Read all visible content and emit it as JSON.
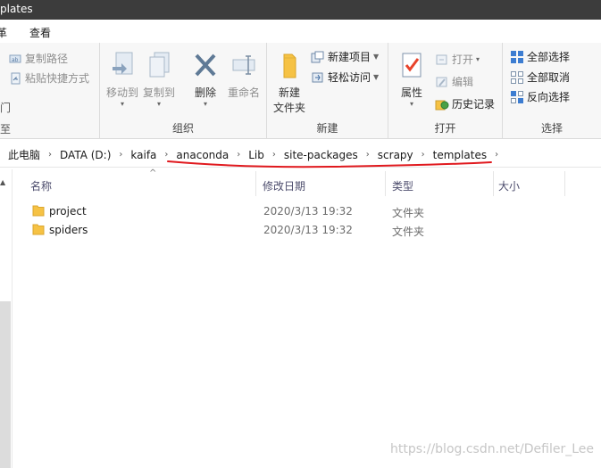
{
  "window": {
    "title": "plates"
  },
  "menu": {
    "tab_partial": "革",
    "tab_view": "查看"
  },
  "ribbon": {
    "clipboard": {
      "copy_path": "复制路径",
      "paste_shortcut": "粘贴快捷方式"
    },
    "organize": {
      "title": "组织",
      "move_to": "移动到",
      "copy_to": "复制到",
      "delete": "删除",
      "rename": "重命名"
    },
    "new": {
      "title": "新建",
      "new_folder_line1": "新建",
      "new_folder_line2": "文件夹",
      "new_item": "新建项目",
      "easy_access": "轻松访问"
    },
    "open": {
      "title": "打开",
      "properties": "属性",
      "open": "打开",
      "edit": "编辑",
      "history": "历史记录"
    },
    "select": {
      "title": "选择",
      "select_all": "全部选择",
      "select_none": "全部取消",
      "invert": "反向选择"
    }
  },
  "address": {
    "crumbs": [
      "此电脑",
      "DATA (D:)",
      "kaifa",
      "anaconda",
      "Lib",
      "site-packages",
      "scrapy",
      "templates"
    ]
  },
  "columns": {
    "name": "名称",
    "modified": "修改日期",
    "type": "类型",
    "size": "大小"
  },
  "files": [
    {
      "name": "project",
      "modified": "2020/3/13 19:32",
      "type": "文件夹"
    },
    {
      "name": "spiders",
      "modified": "2020/3/13 19:32",
      "type": "文件夹"
    }
  ],
  "watermark": "https://blog.csdn.net/Defiler_Lee",
  "colors": {
    "underline": "#e0191e",
    "folder": "#f6c244",
    "titlebar": "#3c3c3c"
  }
}
